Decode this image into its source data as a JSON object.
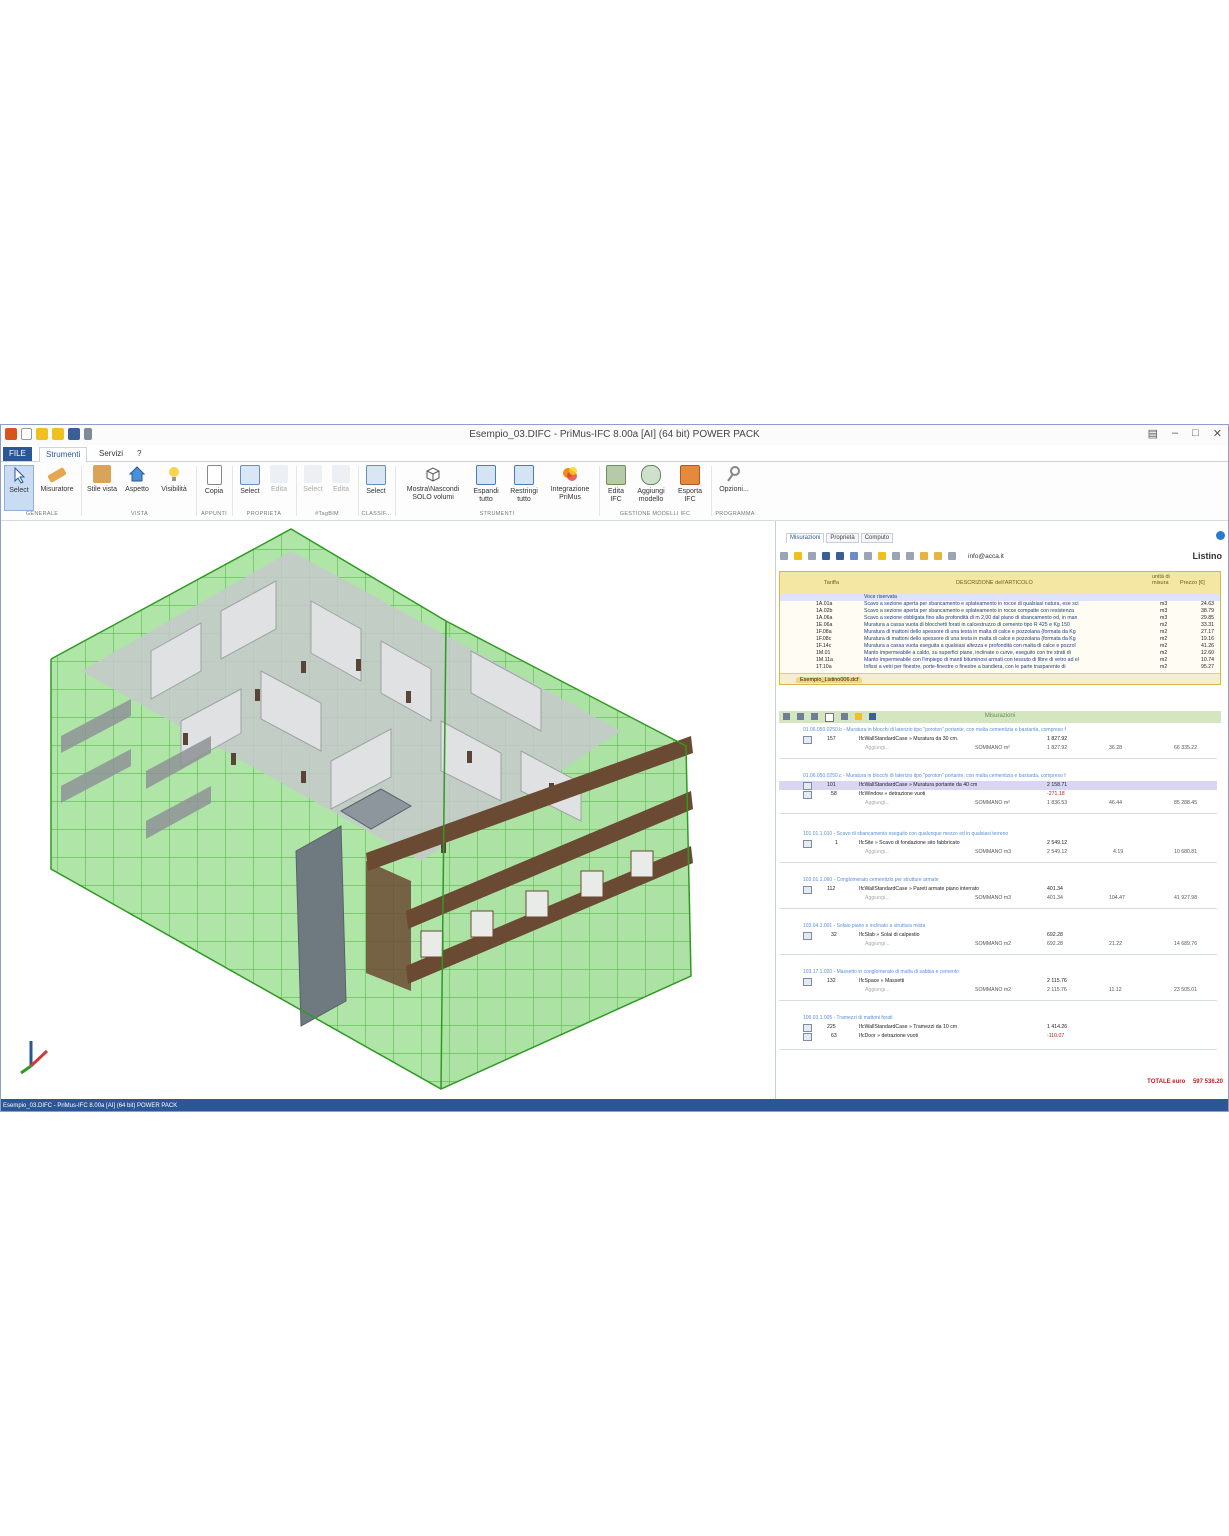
{
  "window": {
    "title": "Esempio_03.DIFC - PriMus-IFC  8.00a [AI]  (64 bit)  POWER PACK",
    "status_text": "Esempio_03.DIFC - PriMus-IFC  8.00a [AI]  (64 bit)  POWER PACK"
  },
  "tabs": [
    "FILE",
    "Strumenti",
    "Servizi",
    "?"
  ],
  "ribbon": {
    "buttons": [
      {
        "label": "Select",
        "icon": "pointer-icon"
      },
      {
        "label": "Misuratore",
        "icon": "ruler-pencil-icon"
      },
      {
        "label": "Stile vista",
        "icon": "cube-style-icon"
      },
      {
        "label": "Aspetto",
        "icon": "house-icon"
      },
      {
        "label": "Visibilità",
        "icon": "lightbulb-icon"
      },
      {
        "label": "Copia",
        "icon": "copy-icon"
      },
      {
        "label": "Select",
        "icon": "select-properties-icon"
      },
      {
        "label": "Edita",
        "icon": "edit-icon"
      },
      {
        "label": "Select",
        "icon": "tag-select-icon"
      },
      {
        "label": "Edita",
        "icon": "tag-edit-icon"
      },
      {
        "label": "Select",
        "icon": "classify-select-icon"
      },
      {
        "label": "Mostra\\Nascondi SOLO volumi",
        "icon": "wireframe-cube-icon"
      },
      {
        "label": "Espandi tutto",
        "icon": "expand-tree-icon"
      },
      {
        "label": "Restringi tutto",
        "icon": "collapse-tree-icon"
      },
      {
        "label": "Integrazione PriMus",
        "icon": "primus-logo-icon"
      },
      {
        "label": "Edita IFC",
        "icon": "edit-ifc-icon"
      },
      {
        "label": "Aggiungi modello",
        "icon": "add-model-icon"
      },
      {
        "label": "Esporta IFC",
        "icon": "export-ifc-icon"
      },
      {
        "label": "Opzioni...",
        "icon": "keys-icon"
      }
    ],
    "groups": [
      "GENERALE",
      "VISTA",
      "APPUNTI",
      "PROPRIETÀ",
      "#TagBIM",
      "CLASSIF...",
      "STRUMENTI",
      "GESTIONE MODELLI IFC",
      "PROGRAMMA"
    ]
  },
  "panel": {
    "tabs": [
      "Misurazioni",
      "Proprietà",
      "Computo"
    ],
    "user": "info@acca.it",
    "listino_title": "Listino",
    "listino": {
      "headers": [
        "Tariffa",
        "DESCRIZIONE dell'ARTICOLO",
        "unità di misura",
        "Prezzo [€]"
      ],
      "rows": [
        {
          "code": "",
          "desc": "Voce riservata",
          "unit": "",
          "price": ""
        },
        {
          "code": "1A.01a",
          "desc": "Scavo a sezione aperta per sbancamento e splateamento in rocce di qualsiasi natura, ese sci",
          "unit": "m3",
          "price": "24.63"
        },
        {
          "code": "1A.02b",
          "desc": "Scavo a sezione aperta per sbancamento e splateamento in rocce compatte con resistenza",
          "unit": "m3",
          "price": "38.79"
        },
        {
          "code": "1A.06a",
          "desc": "Scavo a sezione obbligata fino alla profondità di m 2,00 dal piano di sbancamento od, in man",
          "unit": "m3",
          "price": "29.85"
        },
        {
          "code": "1E.06a",
          "desc": "Muratura a cassa vuota di blocchetti forati in calcestruzzo di cemento tipo R 425 e Kg 150",
          "unit": "m2",
          "price": "33.31"
        },
        {
          "code": "1F.08a",
          "desc": "Muratura di mattoni dello spessore di una testa in malta di calce e pozzolana (formata da Kg",
          "unit": "m2",
          "price": "27.17"
        },
        {
          "code": "1F.08c",
          "desc": "Muratura di mattoni dello spessore di una testa in malta di calce e pozzolana (formata da Kg",
          "unit": "m2",
          "price": "19.16"
        },
        {
          "code": "1F.14c",
          "desc": "Muratura a cassa vuota eseguita a qualsiasi altezza e profondità con malta di calce e pozzol",
          "unit": "m2",
          "price": "41.26"
        },
        {
          "code": "1M.01",
          "desc": "Manto impermeabile a caldo, su superfici piane, inclinate o curve, eseguito con tre strati di",
          "unit": "m2",
          "price": "12.60"
        },
        {
          "code": "1M.11a",
          "desc": "Manto impermeabile con l'impiego di manti bituminosi armati con tessuto di fibre di vetro ad el",
          "unit": "m2",
          "price": "10.74"
        },
        {
          "code": "1T.10a",
          "desc": "Infissi a vetri per finestre, porte-finestre o finestre a bandiera, con le parte trasparente di",
          "unit": "m2",
          "price": "95.27"
        }
      ],
      "file_tab": "Esempio_Listino006.dcf"
    },
    "misurazioni_label": "Misurazioni",
    "groups": [
      {
        "title": "01.06.050.0250.b - Muratura in blocchi di laterizio tipo \"poroton\" portante, con malta cementizia e bastarda, compreso f",
        "rows": [
          {
            "num": "157",
            "name": "IfcWallStandardCase  »  Muratura da 30 cm.",
            "qty": "1 827.92",
            "unit_price": "",
            "total": ""
          },
          {
            "num": "",
            "name": "Aggiungi...",
            "qty": "SOMMANO m²",
            "qty2": "1 827.92",
            "unit_price": "36.28",
            "total": "66 335.22"
          }
        ]
      },
      {
        "title": "01.06.050.0250.c - Muratura in blocchi di laterizio tipo \"poroton\" portante, con malta cementizia e bastarda, compreso f",
        "rows": [
          {
            "num": "101",
            "name": "IfcWallStandardCase  »  Muratura portante da 40 cm",
            "qty": "2 158.71",
            "unit_price": "",
            "total": ""
          },
          {
            "num": "58",
            "name": "IfcWindow  »  detrazione vuoti",
            "qty": "-271.18",
            "unit_price": "",
            "total": ""
          },
          {
            "num": "",
            "name": "Aggiungi...",
            "qty": "SOMMANO m²",
            "qty2": "1 836.53",
            "unit_price": "46.44",
            "total": "85 288.45"
          }
        ]
      },
      {
        "title": "101.01.1.010 - Scavo di sbancamento eseguito con qualunque mezzo ed in qualsiasi terreno",
        "rows": [
          {
            "num": "1",
            "name": "IfcSite  »  Scavo di fondazione sito fabbricato",
            "qty": "2 549.12",
            "unit_price": "",
            "total": ""
          },
          {
            "num": "",
            "name": "Aggiungi...",
            "qty": "SOMMANO m3",
            "qty2": "2 549.12",
            "unit_price": "4.19",
            "total": "10 680.81"
          }
        ]
      },
      {
        "title": "103.01.1.060 - Conglomerato cementizio per strutture armate",
        "rows": [
          {
            "num": "112",
            "name": "IfcWallStandardCase  »  Pareti armate piano interrato",
            "qty": "401.34",
            "unit_price": "",
            "total": ""
          },
          {
            "num": "",
            "name": "Aggiungi...",
            "qty": "SOMMANO m3",
            "qty2": "401.34",
            "unit_price": "104.47",
            "total": "41 927.98"
          }
        ]
      },
      {
        "title": "103.04.1.001 - Solaio piano e inclinato a struttura mista",
        "rows": [
          {
            "num": "32",
            "name": "IfcSlab  »  Solai di calpestio",
            "qty": "692.28",
            "unit_price": "",
            "total": ""
          },
          {
            "num": "",
            "name": "Aggiungi...",
            "qty": "SOMMANO m2",
            "qty2": "692.28",
            "unit_price": "21.22",
            "total": "14 689.76"
          }
        ]
      },
      {
        "title": "103.17.1.020 - Massetto in conglomerato di malta di sabbia e cemento",
        "rows": [
          {
            "num": "132",
            "name": "IfcSpace  »  Massetti",
            "qty": "2 115.76",
            "unit_price": "",
            "total": ""
          },
          {
            "num": "",
            "name": "Aggiungi...",
            "qty": "SOMMANO m2",
            "qty2": "2 115.76",
            "unit_price": "11.12",
            "total": "23 505.01"
          }
        ]
      },
      {
        "title": "106.03.1.005 - Tramezzi di mattoni forati",
        "rows": [
          {
            "num": "225",
            "name": "IfcWallStandardCase  »  Tramezzi da 10 cm",
            "qty": "1 414.26",
            "unit_price": "",
            "total": ""
          },
          {
            "num": "63",
            "name": "IfcDoor  »  detrazione vuoti",
            "qty": "-110.07",
            "unit_price": "",
            "total": ""
          }
        ]
      }
    ],
    "total_label": "TOTALE   euro",
    "total_value": "597 536.20"
  },
  "colors": {
    "accent": "#2b5797",
    "building_green": "#49c23a",
    "interior_gray": "#b9bcbd",
    "balcony_brown": "#6b4a33",
    "listino_header": "#f4e7a4",
    "misurazioni_bar": "#d3e6c0",
    "total_red": "#c21c1c"
  }
}
